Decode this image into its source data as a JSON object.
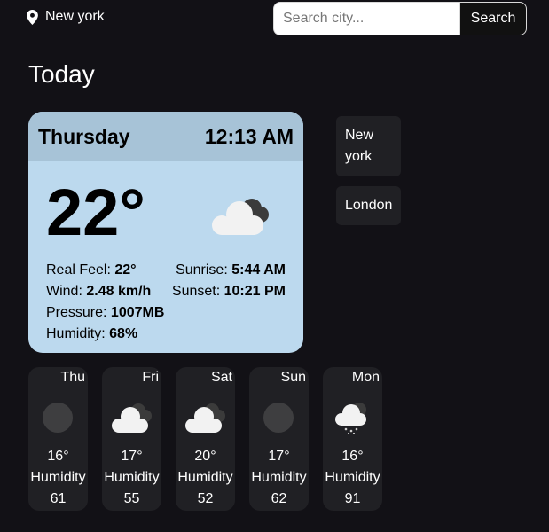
{
  "header": {
    "location": "New york",
    "search_placeholder": "Search city...",
    "search_button": "Search"
  },
  "today_label": "Today",
  "current": {
    "day": "Thursday",
    "time": "12:13 AM",
    "temp": "22°",
    "icon": "cloudy-icon",
    "real_feel_label": "Real Feel:",
    "real_feel": "22°",
    "wind_label": "Wind:",
    "wind": "2.48 km/h",
    "pressure_label": "Pressure:",
    "pressure": "1007MB",
    "humidity_label": "Humidity:",
    "humidity": "68%",
    "sunrise_label": "Sunrise:",
    "sunrise": "5:44 AM",
    "sunset_label": "Sunset:",
    "sunset": "10:21 PM"
  },
  "saved_cities": [
    {
      "name": "New york"
    },
    {
      "name": "London"
    }
  ],
  "forecast": [
    {
      "day": "Thu",
      "icon": "moon-icon",
      "temp": "16°",
      "humidity_label": "Humidity",
      "humidity": "61"
    },
    {
      "day": "Fri",
      "icon": "cloudy-icon",
      "temp": "17°",
      "humidity_label": "Humidity",
      "humidity": "55"
    },
    {
      "day": "Sat",
      "icon": "cloudy-icon",
      "temp": "20°",
      "humidity_label": "Humidity",
      "humidity": "52"
    },
    {
      "day": "Sun",
      "icon": "moon-icon",
      "temp": "17°",
      "humidity_label": "Humidity",
      "humidity": "62"
    },
    {
      "day": "Mon",
      "icon": "rain-icon",
      "temp": "16°",
      "humidity_label": "Humidity",
      "humidity": "91"
    }
  ],
  "colors": {
    "background": "#121116",
    "card": "#bcd9ee",
    "card_header": "#a7c3d7",
    "tile": "#202024"
  }
}
